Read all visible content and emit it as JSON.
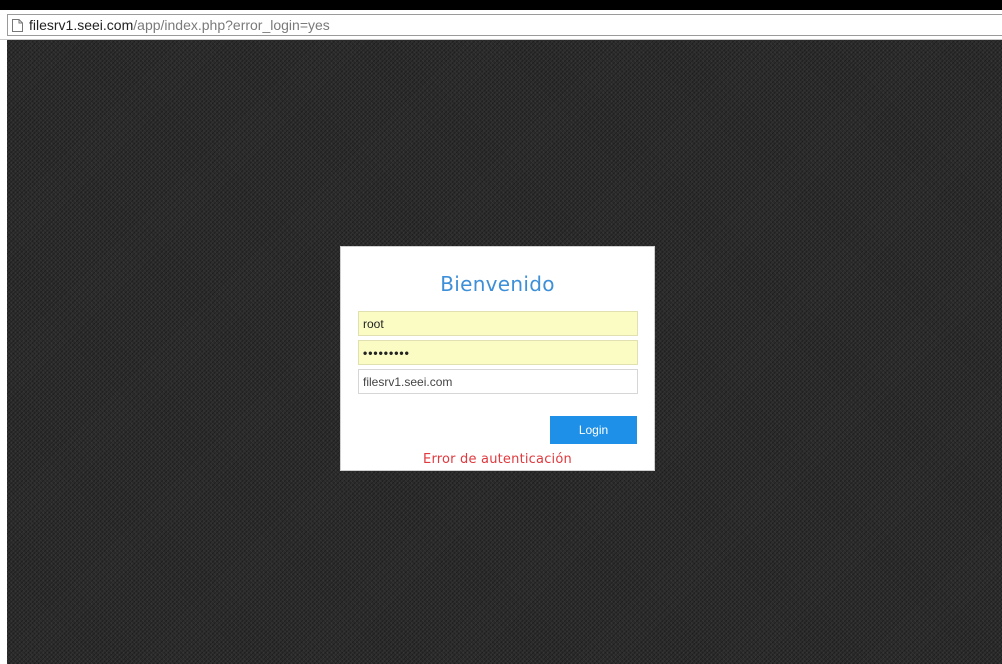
{
  "browser": {
    "url_host": "filesrv1.seei.com",
    "url_path": "/app/index.php?error_login=yes",
    "icon": "page-icon"
  },
  "login": {
    "title": "Bienvenido",
    "username_value": "root",
    "password_mask": "•••••••••",
    "server_value": "filesrv1.seei.com",
    "login_label": "Login",
    "error_message": "Error de autenticación"
  },
  "colors": {
    "accent": "#1e90e8",
    "title": "#3d8fd8",
    "error": "#e0393e",
    "autofill": "#fafcc4",
    "background": "#2a2a2a"
  }
}
